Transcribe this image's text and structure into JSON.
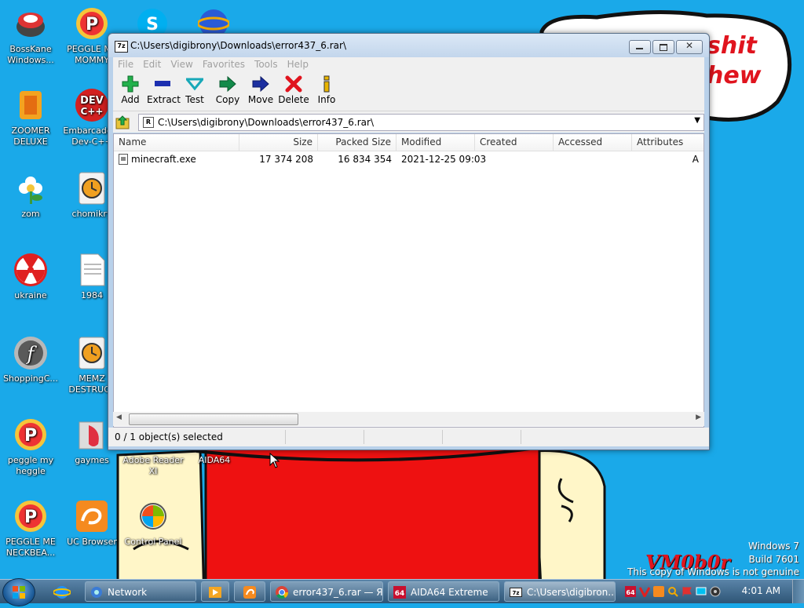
{
  "desktop": {
    "icons": [
      {
        "label": "BossKane Windows...",
        "icon": "bosskane-icon"
      },
      {
        "label": "PEGGLE ME MOMMY",
        "icon": "peggle-icon"
      },
      {
        "label": "ZOOMER DELUXE",
        "icon": "zoomer-icon"
      },
      {
        "label": "Embarcadero Dev-C++",
        "icon": "devcpp-icon"
      },
      {
        "label": "zom",
        "icon": "flower-icon"
      },
      {
        "label": "chomikry",
        "icon": "clock-icon"
      },
      {
        "label": "ukraine",
        "icon": "radiation-icon"
      },
      {
        "label": "1984",
        "icon": "text-file-icon"
      },
      {
        "label": "ShoppingC...",
        "icon": "flash-icon"
      },
      {
        "label": "MEMZ DESTRUCT",
        "icon": "clock-icon"
      },
      {
        "label": "peggle my heggle",
        "icon": "peggle-icon"
      },
      {
        "label": "gaymes",
        "icon": "folder-icon"
      },
      {
        "label": "Adobe Reader XI",
        "icon": "adobe-reader-icon"
      },
      {
        "label": "AIDA64",
        "icon": "aida64-icon"
      },
      {
        "label": "PEGGLE ME NECKBEA...",
        "icon": "peggle-icon"
      },
      {
        "label": "UC Browser",
        "icon": "uc-browser-icon"
      },
      {
        "label": "Control Panel",
        "icon": "control-panel-icon"
      }
    ],
    "wallpaper_text": "shit hew",
    "wallpaper_sign": "VM0b0r"
  },
  "window": {
    "title": "C:\\Users\\digibrony\\Downloads\\error437_6.rar\\",
    "app_icon_text": "7z",
    "menu": [
      "File",
      "Edit",
      "View",
      "Favorites",
      "Tools",
      "Help"
    ],
    "toolbar": [
      {
        "label": "Add",
        "icon": "add-icon",
        "color": "#22b14c"
      },
      {
        "label": "Extract",
        "icon": "extract-icon",
        "color": "#1c2fb0"
      },
      {
        "label": "Test",
        "icon": "test-icon",
        "color": "#18a8b8"
      },
      {
        "label": "Copy",
        "icon": "copy-icon",
        "color": "#138a4a"
      },
      {
        "label": "Move",
        "icon": "move-icon",
        "color": "#1c2fa0"
      },
      {
        "label": "Delete",
        "icon": "delete-icon",
        "color": "#e0141e"
      },
      {
        "label": "Info",
        "icon": "info-icon",
        "color": "#e8b400"
      }
    ],
    "address": "C:\\Users\\digibrony\\Downloads\\error437_6.rar\\",
    "columns": [
      "Name",
      "Size",
      "Packed Size",
      "Modified",
      "Created",
      "Accessed",
      "Attributes"
    ],
    "files": [
      {
        "name": "minecraft.exe",
        "size": "17 374 208",
        "packed": "16 834 354",
        "modified": "2021-12-25 09:03",
        "created": "",
        "accessed": "",
        "attributes": "A"
      }
    ],
    "status": "0 / 1 object(s) selected"
  },
  "taskbar": {
    "tasks": [
      {
        "label": "Network",
        "icon": "network-icon"
      },
      {
        "label": "",
        "icon": "media-player-icon"
      },
      {
        "label": "",
        "icon": "uc-browser-icon"
      },
      {
        "label": "error437_6.rar — Я...",
        "icon": "chrome-icon"
      },
      {
        "label": "AIDA64 Extreme",
        "icon": "aida64-icon"
      },
      {
        "label": "C:\\Users\\digibron...",
        "icon": "7zip-icon"
      }
    ],
    "clock": "4:01 AM",
    "watermark_line1": "Windows 7",
    "watermark_line2": "Build 7601",
    "watermark_line3": "This copy of Windows is not genuine"
  }
}
